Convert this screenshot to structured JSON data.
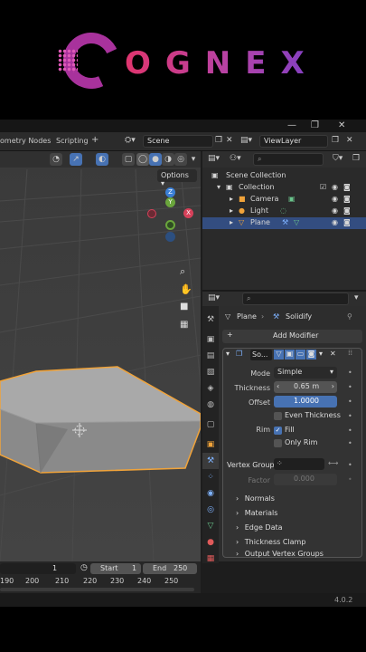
{
  "brand": {
    "name": "OGNEX"
  },
  "window": {
    "minimize": "—",
    "maximize": "❐",
    "close": "✕"
  },
  "topbar": {
    "tabs": [
      "ometry Nodes",
      "Scripting"
    ],
    "add_tab": "+",
    "scene_label": "Scene",
    "view_layer_label": "ViewLayer"
  },
  "viewport": {
    "options_label": "Options",
    "gizmo": {
      "z": "Z",
      "y": "Y",
      "x": "X"
    }
  },
  "outliner": {
    "search_placeholder": "",
    "items": [
      {
        "label": "Scene Collection"
      },
      {
        "label": "Collection"
      },
      {
        "label": "Camera"
      },
      {
        "label": "Light"
      },
      {
        "label": "Plane"
      }
    ]
  },
  "properties": {
    "breadcrumb_object": "Plane",
    "breadcrumb_modifier": "Solidify",
    "add_modifier_label": "Add Modifier",
    "modifier_name": "So...",
    "mode_label": "Mode",
    "mode_value": "Simple",
    "thickness_label": "Thickness",
    "thickness_value": "0.65 m",
    "offset_label": "Offset",
    "offset_value": "1.0000",
    "even_thickness_label": "Even Thickness",
    "rim_label": "Rim",
    "fill_label": "Fill",
    "only_rim_label": "Only Rim",
    "vertex_group_label": "Vertex Group",
    "factor_label": "Factor",
    "factor_value": "0.000",
    "subpanels": [
      "Normals",
      "Materials",
      "Edge Data",
      "Thickness Clamp",
      "Output Vertex Groups"
    ]
  },
  "timeline": {
    "current_frame": "1",
    "start_label": "Start",
    "start_value": "1",
    "end_label": "End",
    "end_value": "250",
    "ticks": [
      "190",
      "200",
      "210",
      "220",
      "230",
      "240",
      "250"
    ]
  },
  "statusbar": {
    "version": "4.0.2"
  },
  "colors": {
    "accent": "#4772b3",
    "selected_outline": "#f0a33a",
    "brand_start": "#e0356e",
    "brand_end": "#7d3fc4"
  }
}
